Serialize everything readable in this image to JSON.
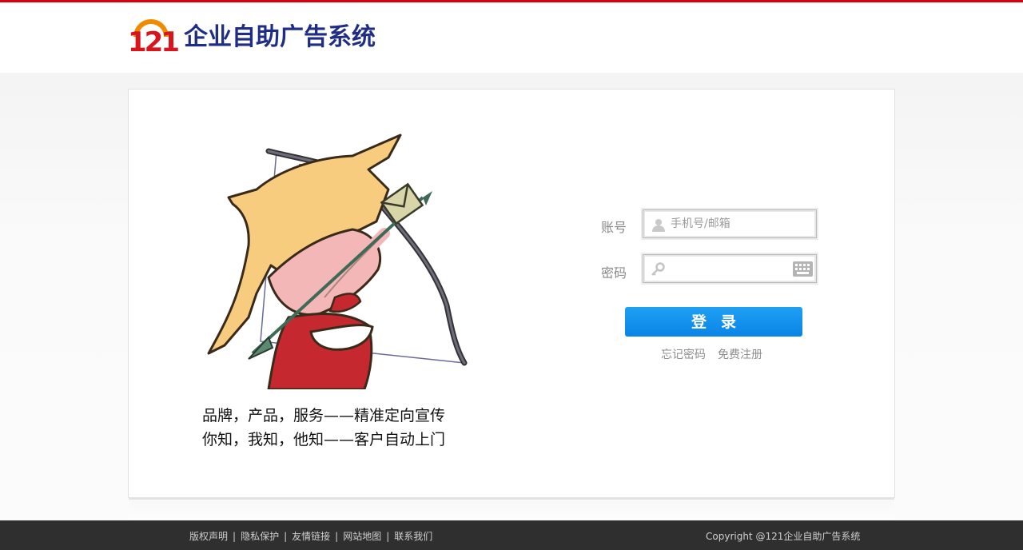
{
  "header": {
    "logo_number": "121",
    "logo_title": "企业自助广告系统"
  },
  "hero": {
    "illustration": "cupid-archer-illustration",
    "slogan_line1": "品牌，产品，服务——精准定向宣传",
    "slogan_line2": "你知，我知，他知——客户自动上门"
  },
  "login": {
    "account_label": "账号",
    "account_placeholder": "手机号/邮箱",
    "account_value": "",
    "password_label": "密码",
    "password_value": "",
    "submit_label": "登录",
    "forgot_link": "忘记密码",
    "register_link": "免费注册",
    "icons": [
      "user-icon",
      "key-icon",
      "keyboard-icon"
    ]
  },
  "footer": {
    "links": [
      "版权声明",
      "隐私保护",
      "友情链接",
      "网站地图",
      "联系我们"
    ],
    "copyright": "Copyright @121企业自助广告系统"
  },
  "colors": {
    "top_bar": "#d8000f",
    "logo_red": "#d8141c",
    "logo_orange": "#f08a00",
    "logo_text": "#1f2d84",
    "button": "#0a84e6",
    "footer_bg": "#2f2f2f"
  }
}
